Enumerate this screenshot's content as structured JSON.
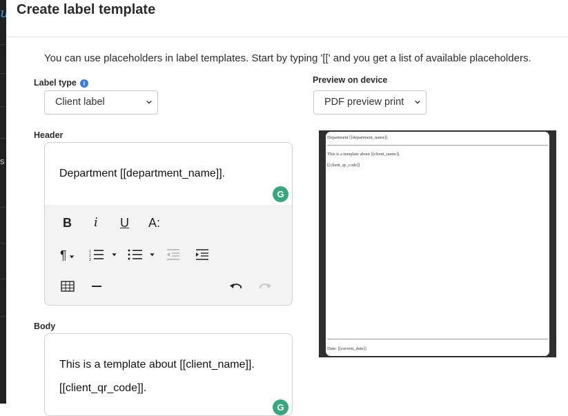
{
  "modal": {
    "title": "Create label template",
    "help_text": "You can use placeholders in label templates. Start by typing '[[' and you get a list of available placeholders."
  },
  "label_type": {
    "label": "Label type",
    "selected": "Client label",
    "info_icon": "info-icon"
  },
  "preview_device": {
    "label": "Preview on device",
    "selected": "PDF preview print"
  },
  "header_editor": {
    "label": "Header",
    "content": "Department [[department_name]].",
    "toolbar": {
      "bold": "B",
      "italic": "i",
      "underline": "U",
      "font_size": "A:",
      "paragraph": "¶"
    }
  },
  "body_editor": {
    "label": "Body",
    "line1": "This is a template about [[client_name]].",
    "line2": "[[client_qr_code]]."
  },
  "preview": {
    "header_text": "Department [[department_name]]",
    "body_line1": "This is a template about [[client_name]].",
    "body_line2": "[[client_qr_code]]",
    "footer_text": "Date: [[current_date]]"
  },
  "colors": {
    "accent": "#3b7bd6",
    "grammarly": "#3aa57e",
    "preview_bg": "#2f2f2f"
  }
}
